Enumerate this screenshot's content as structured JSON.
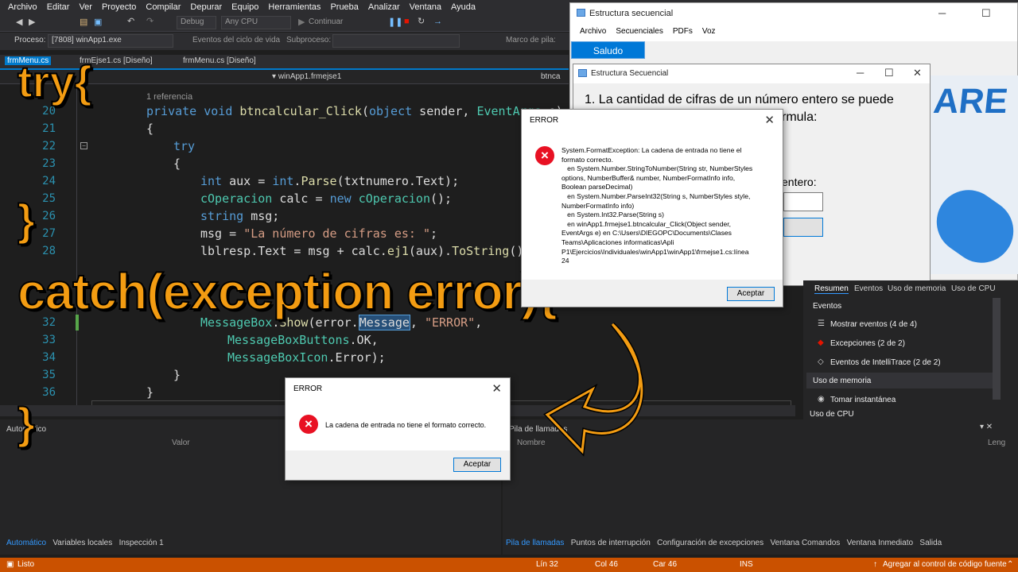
{
  "menu": [
    "Archivo",
    "Editar",
    "Ver",
    "Proyecto",
    "Compilar",
    "Depurar",
    "Equipo",
    "Herramientas",
    "Prueba",
    "Analizar",
    "Ventana",
    "Ayuda"
  ],
  "toolbar": {
    "config": "Debug",
    "platform": "Any CPU",
    "continue": "Continuar"
  },
  "toolbar2": {
    "process_label": "Proceso:",
    "process": "[7808] winApp1.exe",
    "lifecycle": "Eventos del ciclo de vida",
    "thread": "Subproceso:",
    "stack": "Marco de pila:"
  },
  "tabs": [
    "frmMenu.cs",
    "frmEjse1.cs [Diseño]",
    "frmMenu.cs [Diseño]"
  ],
  "nav": {
    "member": "winApp1.frmejse1",
    "right": "btnca"
  },
  "code": {
    "refs": "1 referencia",
    "lines": [
      {
        "n": "20",
        "t": "private void btnCalcular_Click(object sender, EventArgs e)"
      },
      {
        "n": "21",
        "t": "{"
      },
      {
        "n": "22",
        "t": "try"
      },
      {
        "n": "23",
        "t": "{"
      },
      {
        "n": "24",
        "t": "int aux = int.Parse(txtnumero.Text);"
      },
      {
        "n": "25",
        "t": "cOperacion calc = new cOperacion();"
      },
      {
        "n": "26",
        "t": "string msg;"
      },
      {
        "n": "27",
        "t": "msg = \"La número de cifras es: \";"
      },
      {
        "n": "28",
        "t": "lblresp.Text = msg + calc.ej1(aux).ToString();"
      },
      {
        "n": "32",
        "t": "MessageBox.Show(error.Message, \"ERROR\","
      },
      {
        "n": "33",
        "t": "MessageBoxButtons.OK,"
      },
      {
        "n": "34",
        "t": "MessageBoxIcon.Error);"
      },
      {
        "n": "35",
        "t": "}"
      },
      {
        "n": "36",
        "t": "}"
      }
    ]
  },
  "overlay": {
    "try": "try{",
    "close1": "}",
    "catch": "catch(exception error){",
    "close2": "}"
  },
  "winapp": {
    "title": "Estructura secuencial",
    "menu": [
      "Archivo",
      "Secuenciales",
      "PDFs",
      "Voz"
    ],
    "button": "Saludo"
  },
  "win2": {
    "title": "Estructura Secuencial",
    "text1": "1. La cantidad de cifras de un número entero se puede",
    "text2": "rmula:",
    "text3": "entero:"
  },
  "diag": {
    "tabs": [
      "Resumen",
      "Eventos",
      "Uso de memoria",
      "Uso de CPU"
    ],
    "events_header": "Eventos",
    "items": [
      "Mostrar eventos (4 de 4)",
      "Excepciones (2 de 2)",
      "Eventos de IntelliTrace (2 de 2)"
    ],
    "memory_header": "Uso de memoria",
    "snapshot": "Tomar instantánea",
    "cpu": "Uso de CPU"
  },
  "dlg1": {
    "title": "ERROR",
    "message": "System.FormatException: La cadena de entrada no tiene el\nformato correcto.\n   en System.Number.StringToNumber(String str, NumberStyles\noptions, NumberBuffer& number, NumberFormatInfo info,\nBoolean parseDecimal)\n   en System.Number.ParseInt32(String s, NumberStyles style,\nNumberFormatInfo info)\n   en System.Int32.Parse(String s)\n   en winApp1.frmejse1.btncalcular_Click(Object sender,\nEventArgs e) en C:\\Users\\DIEGOPC\\Documents\\Clases\nTeams\\Aplicaciones informaticas\\Apli\nP1\\Ejercicios\\Individuales\\winApp1\\winApp1\\frmejse1.cs:línea\n24",
    "ok": "Aceptar"
  },
  "dlg2": {
    "title": "ERROR",
    "message": "La cadena de entrada no tiene el formato correcto.",
    "ok": "Aceptar"
  },
  "panels": {
    "autos_title": "Automático",
    "value_col": "Valor",
    "callstack_title": "Pila de llamadas",
    "name_col": "Nombre",
    "lang_col": "Leng"
  },
  "bottom_tabs_left": [
    "Automático",
    "Variables locales",
    "Inspección 1"
  ],
  "bottom_tabs_right": [
    "Pila de llamadas",
    "Puntos de interrupción",
    "Configuración de excepciones",
    "Ventana Comandos",
    "Ventana Inmediato",
    "Salida"
  ],
  "status": {
    "ready": "Listo",
    "line": "Lín 32",
    "col": "Col 46",
    "car": "Car 46",
    "ins": "INS",
    "source": "Agregar al control de código fuente"
  },
  "colors": {
    "accent": "#007acc",
    "status": "#ca5100",
    "overlay": "#f39c12",
    "error": "#e81123"
  }
}
